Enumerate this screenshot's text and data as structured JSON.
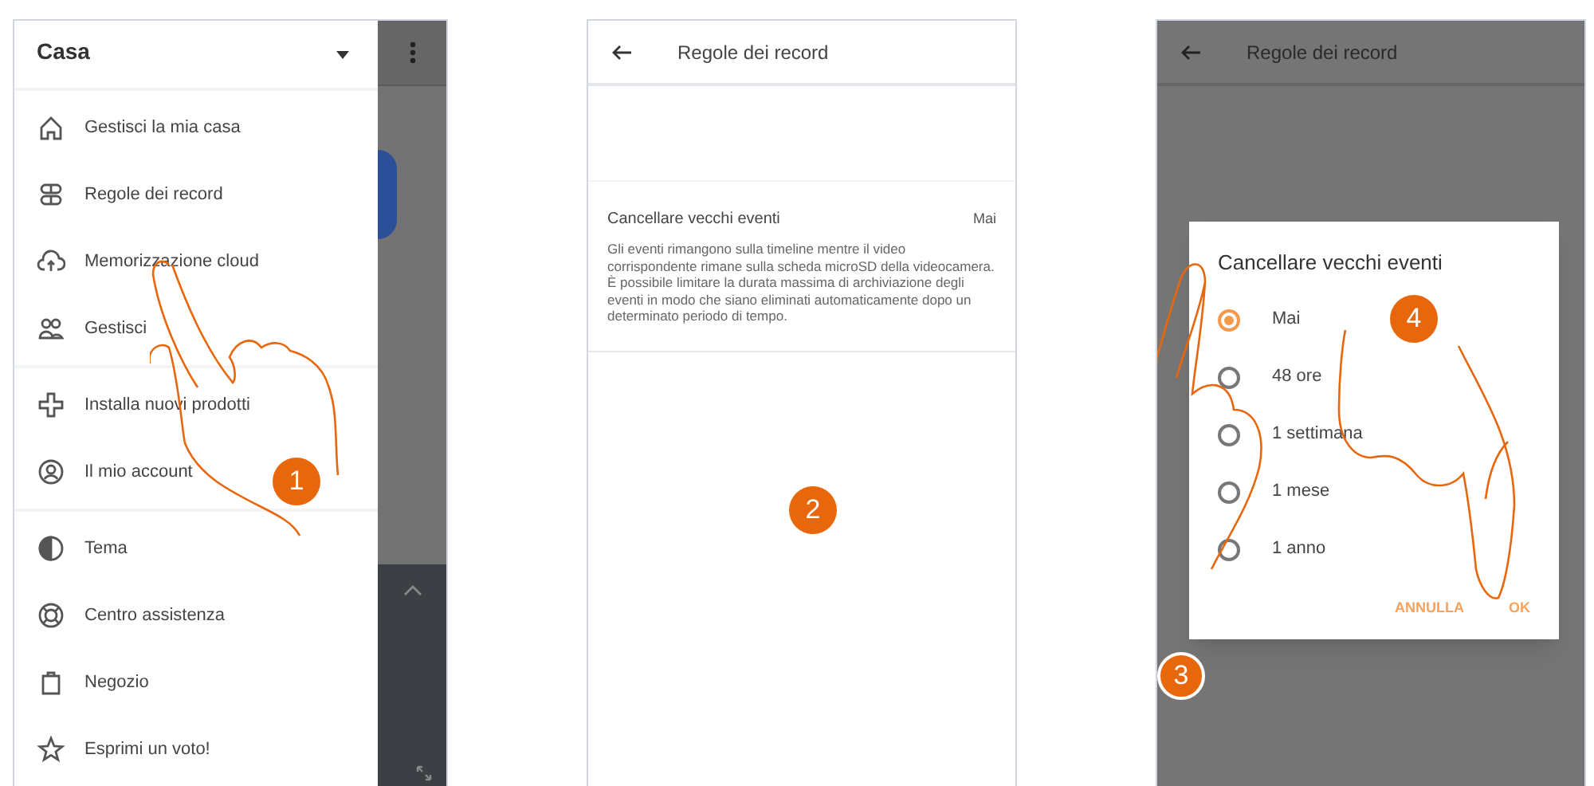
{
  "drawer": {
    "title": "Casa",
    "sections": [
      {
        "items": [
          {
            "label": "Gestisci la mia casa"
          },
          {
            "label": "Regole dei record"
          },
          {
            "label": "Memorizzazione cloud"
          },
          {
            "label": "Gestisci"
          }
        ]
      },
      {
        "items": [
          {
            "label": "Installa nuovi prodotti"
          },
          {
            "label": "Il mio account"
          }
        ]
      },
      {
        "items": [
          {
            "label": "Tema"
          },
          {
            "label": "Centro assistenza"
          },
          {
            "label": "Negozio"
          },
          {
            "label": "Esprimi un voto!"
          }
        ]
      }
    ]
  },
  "record_rules": {
    "title": "Regole dei record",
    "setting": {
      "label": "Cancellare vecchi eventi",
      "value": "Mai",
      "description": "Gli eventi rimangono sulla timeline mentre il video corrispondente rimane sulla scheda microSD della videocamera. È possibile limitare la durata massima di archiviazione degli eventi in modo che siano eliminati automaticamente dopo un determinato periodo di tempo."
    }
  },
  "dialog_screen": {
    "title": "Regole dei record",
    "dialog": {
      "title": "Cancellare vecchi eventi",
      "options": [
        {
          "label": "Mai",
          "selected": true
        },
        {
          "label": "48 ore",
          "selected": false
        },
        {
          "label": "1 settimana",
          "selected": false
        },
        {
          "label": "1 mese",
          "selected": false
        },
        {
          "label": "1 anno",
          "selected": false
        }
      ],
      "buttons": [
        "ANNULLA",
        "OK"
      ]
    }
  },
  "steps": [
    "1",
    "2",
    "3",
    "4"
  ]
}
